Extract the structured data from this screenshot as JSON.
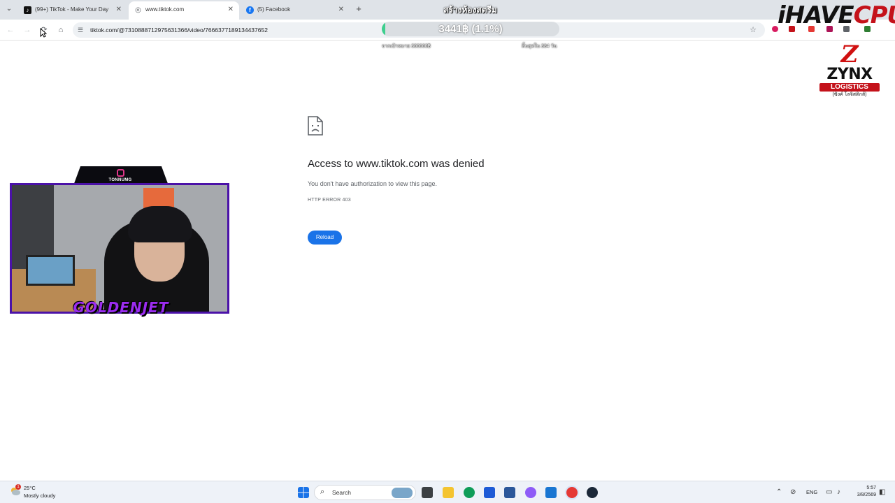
{
  "browser": {
    "tabs": [
      {
        "title": "(99+) TikTok - Make Your Day",
        "favicon": "tiktok-icon",
        "active": false
      },
      {
        "title": "www.tiktok.com",
        "favicon": "globe-icon",
        "active": true
      },
      {
        "title": "(5) Facebook",
        "favicon": "facebook-icon",
        "active": false
      }
    ],
    "url": "tiktok.com/@7310888712975631366/video/7666377189134437652"
  },
  "overlay": {
    "stream_title": "สร้างห้องสตรีม",
    "donation_text": "3441฿ (1.1%)",
    "donation_progress": 0.011,
    "goal_text": "จากเป้าหมาย 300000฿",
    "remaining_text": "สิ้นสุดใน 384 วัน",
    "brand_1": "iHAVE",
    "brand_2": "CPU",
    "sponsor_mark": "Z",
    "sponsor_name": "ZYNX",
    "sponsor_sub": "LOGISTICS",
    "sponsor_thai": "(ซิงค์ โลจิสติกส์)"
  },
  "webcam": {
    "handle": "TONNUMG",
    "name": "GOLDENJET"
  },
  "error_page": {
    "title": "Access to www.tiktok.com was denied",
    "description": "You don't have authorization to view this page.",
    "code": "HTTP ERROR 403",
    "reload_label": "Reload"
  },
  "taskbar": {
    "weather_temp": "25°C",
    "weather_desc": "Mostly cloudy",
    "weather_badge": "1",
    "search_placeholder": "Search",
    "language": "ENG",
    "time": "5:57",
    "date": "3/8/2569"
  },
  "colors": {
    "accent": "#1a73e8",
    "brand_red": "#c4121a",
    "donation_fill": "#3ecf8e",
    "webcam_frame": "#4b12a8"
  }
}
